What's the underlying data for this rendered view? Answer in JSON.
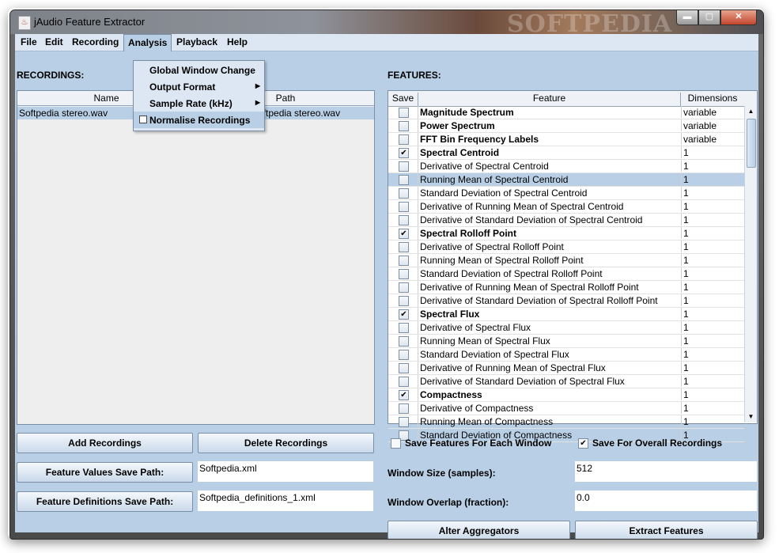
{
  "window": {
    "title": "jAudio Feature Extractor",
    "watermark": "SOFTPEDIA"
  },
  "menu": [
    "File",
    "Edit",
    "Recording",
    "Analysis",
    "Playback",
    "Help"
  ],
  "analysis_menu": {
    "items": [
      "Global Window Change",
      "Output Format",
      "Sample Rate (kHz)",
      "Normalise Recordings"
    ]
  },
  "recordings": {
    "label": "RECORDINGS:",
    "columns": [
      "Name",
      "Path"
    ],
    "rows": [
      {
        "name": "Softpedia stereo.wav",
        "path": "Softpedia stereo.wav"
      }
    ]
  },
  "features": {
    "label": "FEATURES:",
    "columns": [
      "Save",
      "Feature",
      "Dimensions"
    ],
    "rows": [
      {
        "checked": false,
        "bold": true,
        "name": "Magnitude Spectrum",
        "dim": "variable"
      },
      {
        "checked": false,
        "bold": true,
        "name": "Power Spectrum",
        "dim": "variable"
      },
      {
        "checked": false,
        "bold": true,
        "name": "FFT Bin Frequency Labels",
        "dim": "variable"
      },
      {
        "checked": true,
        "bold": true,
        "name": "Spectral Centroid",
        "dim": "1"
      },
      {
        "checked": false,
        "bold": false,
        "name": "Derivative of Spectral Centroid",
        "dim": "1"
      },
      {
        "checked": false,
        "bold": false,
        "name": "Running Mean of Spectral Centroid",
        "dim": "1",
        "selected": true
      },
      {
        "checked": false,
        "bold": false,
        "name": "Standard Deviation of Spectral Centroid",
        "dim": "1"
      },
      {
        "checked": false,
        "bold": false,
        "name": "Derivative of Running Mean of Spectral Centroid",
        "dim": "1"
      },
      {
        "checked": false,
        "bold": false,
        "name": "Derivative of Standard Deviation of Spectral Centroid",
        "dim": "1"
      },
      {
        "checked": true,
        "bold": true,
        "name": "Spectral Rolloff Point",
        "dim": "1"
      },
      {
        "checked": false,
        "bold": false,
        "name": "Derivative of Spectral Rolloff Point",
        "dim": "1"
      },
      {
        "checked": false,
        "bold": false,
        "name": "Running Mean of Spectral Rolloff Point",
        "dim": "1"
      },
      {
        "checked": false,
        "bold": false,
        "name": "Standard Deviation of Spectral Rolloff Point",
        "dim": "1"
      },
      {
        "checked": false,
        "bold": false,
        "name": "Derivative of Running Mean of Spectral Rolloff Point",
        "dim": "1"
      },
      {
        "checked": false,
        "bold": false,
        "name": "Derivative of Standard Deviation of Spectral Rolloff Point",
        "dim": "1"
      },
      {
        "checked": true,
        "bold": true,
        "name": "Spectral Flux",
        "dim": "1"
      },
      {
        "checked": false,
        "bold": false,
        "name": "Derivative of Spectral Flux",
        "dim": "1"
      },
      {
        "checked": false,
        "bold": false,
        "name": "Running Mean of Spectral Flux",
        "dim": "1"
      },
      {
        "checked": false,
        "bold": false,
        "name": "Standard Deviation of Spectral Flux",
        "dim": "1"
      },
      {
        "checked": false,
        "bold": false,
        "name": "Derivative of Running Mean of Spectral Flux",
        "dim": "1"
      },
      {
        "checked": false,
        "bold": false,
        "name": "Derivative of Standard Deviation of Spectral Flux",
        "dim": "1"
      },
      {
        "checked": true,
        "bold": true,
        "name": "Compactness",
        "dim": "1"
      },
      {
        "checked": false,
        "bold": false,
        "name": "Derivative of Compactness",
        "dim": "1"
      },
      {
        "checked": false,
        "bold": false,
        "name": "Running Mean of Compactness",
        "dim": "1"
      },
      {
        "checked": false,
        "bold": false,
        "name": "Standard Deviation of Compactness",
        "dim": "1"
      }
    ]
  },
  "buttons": {
    "add_recordings": "Add Recordings",
    "delete_recordings": "Delete Recordings",
    "feature_values_save_path": "Feature Values Save Path:",
    "feature_definitions_save_path": "Feature Definitions Save Path:",
    "alter_aggregators": "Alter Aggregators",
    "extract_features": "Extract Features"
  },
  "fields": {
    "feature_values_path": "Softpedia.xml",
    "feature_definitions_path": "Softpedia_definitions_1.xml",
    "window_size_label": "Window Size (samples):",
    "window_size": "512",
    "window_overlap_label": "Window Overlap (fraction):",
    "window_overlap": "0.0"
  },
  "options": {
    "save_each_window": {
      "label": "Save Features For Each Window",
      "checked": false
    },
    "save_overall": {
      "label": "Save For Overall Recordings",
      "checked": true
    }
  },
  "icons": {
    "check": "✔",
    "submenu_arrow": "▶",
    "scroll_up": "▲",
    "scroll_down": "▼",
    "minimize": "▬",
    "maximize": "▢",
    "close": "✕"
  },
  "colors": {
    "panel": "#b8cfe5",
    "menubar": "#dce7f3",
    "selection": "#b8cfe5"
  }
}
